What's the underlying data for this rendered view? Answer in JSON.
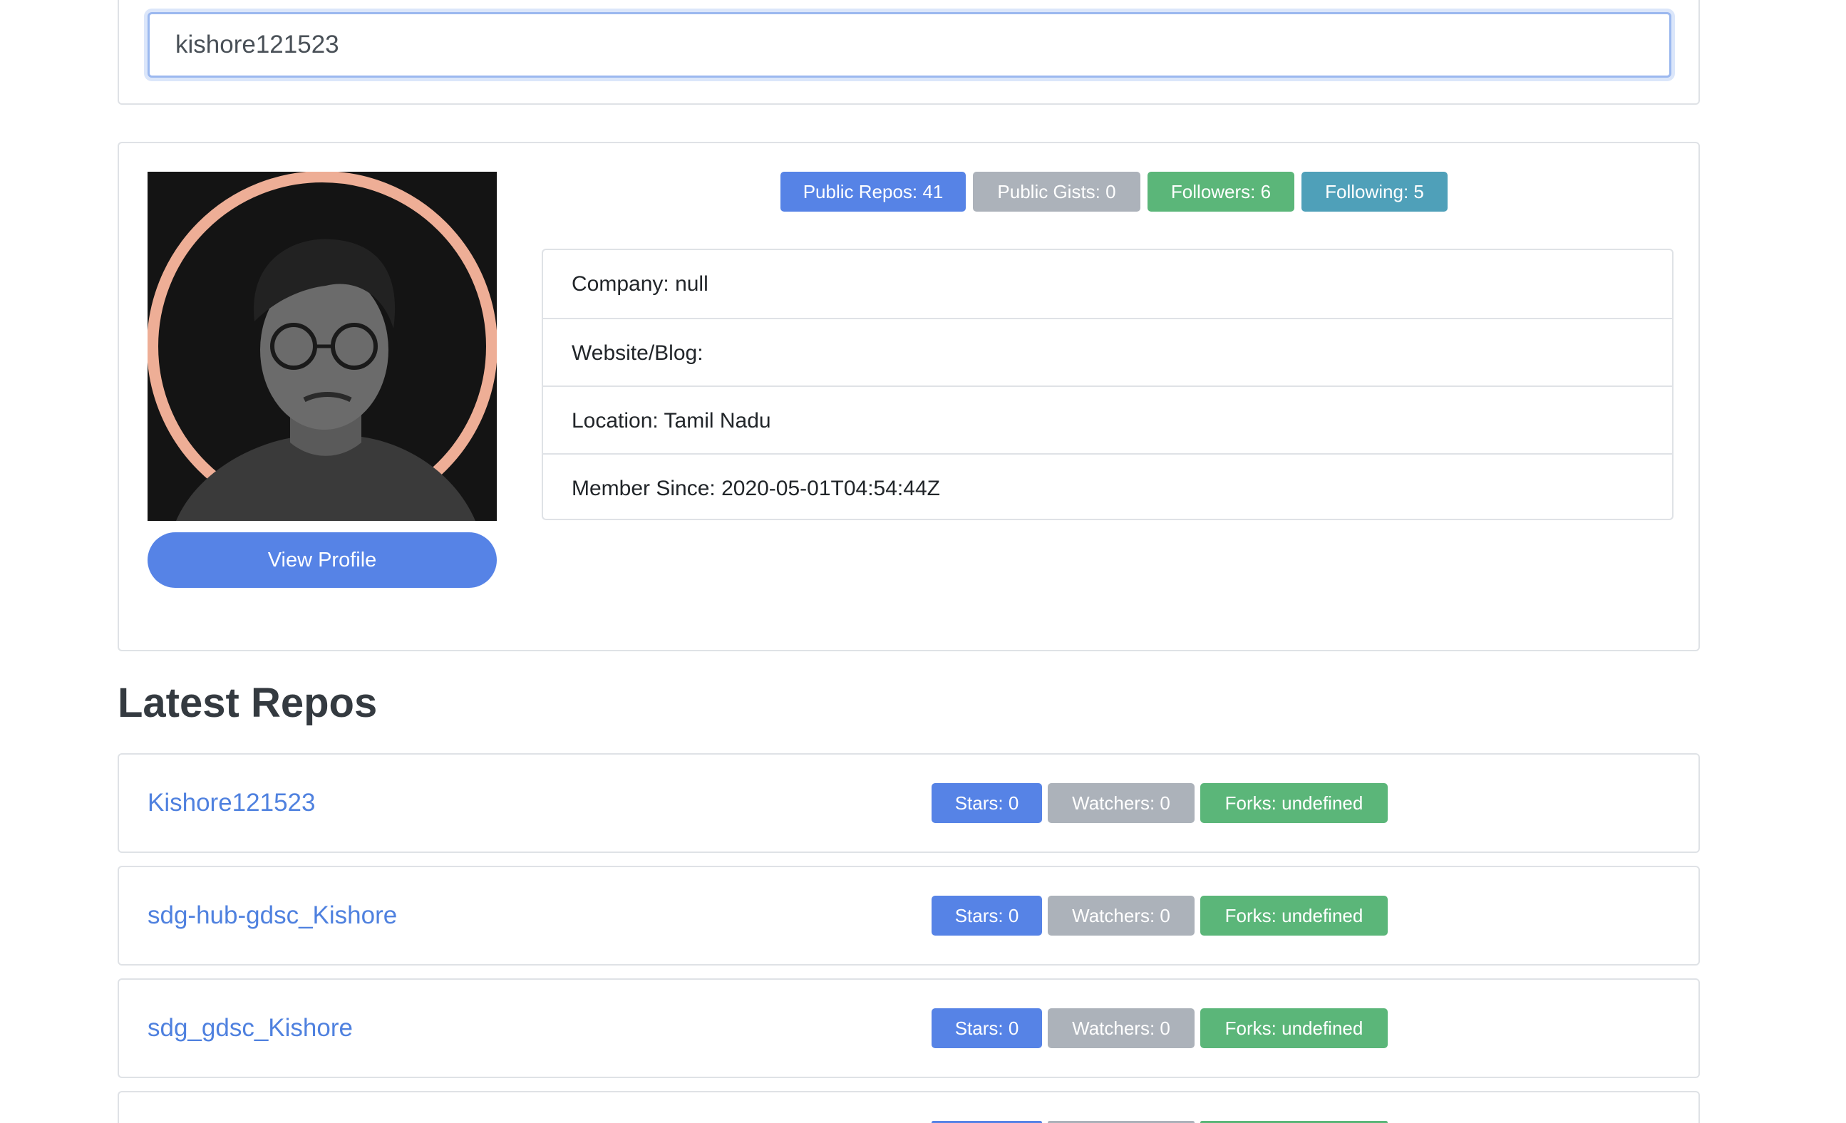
{
  "search": {
    "value": "kishore121523"
  },
  "profile": {
    "view_profile_label": "View Profile",
    "badges": {
      "public_repos": "Public Repos: 41",
      "public_gists": "Public Gists: 0",
      "followers": "Followers: 6",
      "following": "Following: 5"
    },
    "info": {
      "company": "Company: null",
      "website": "Website/Blog:",
      "location": "Location: Tamil Nadu",
      "member_since": "Member Since: 2020-05-01T04:54:44Z"
    }
  },
  "repos": {
    "title": "Latest Repos",
    "items": [
      {
        "name": "Kishore121523",
        "stars": "Stars: 0",
        "watchers": "Watchers: 0",
        "forks": "Forks: undefined"
      },
      {
        "name": "sdg-hub-gdsc_Kishore",
        "stars": "Stars: 0",
        "watchers": "Watchers: 0",
        "forks": "Forks: undefined"
      },
      {
        "name": "sdg_gdsc_Kishore",
        "stars": "Stars: 0",
        "watchers": "Watchers: 0",
        "forks": "Forks: undefined"
      }
    ]
  },
  "colors": {
    "primary": "#5683e6",
    "secondary": "#acb2ba",
    "success": "#5bb679",
    "info": "#4fa0b9",
    "link": "#4f81df",
    "avatar_ring": "#eeae96"
  }
}
